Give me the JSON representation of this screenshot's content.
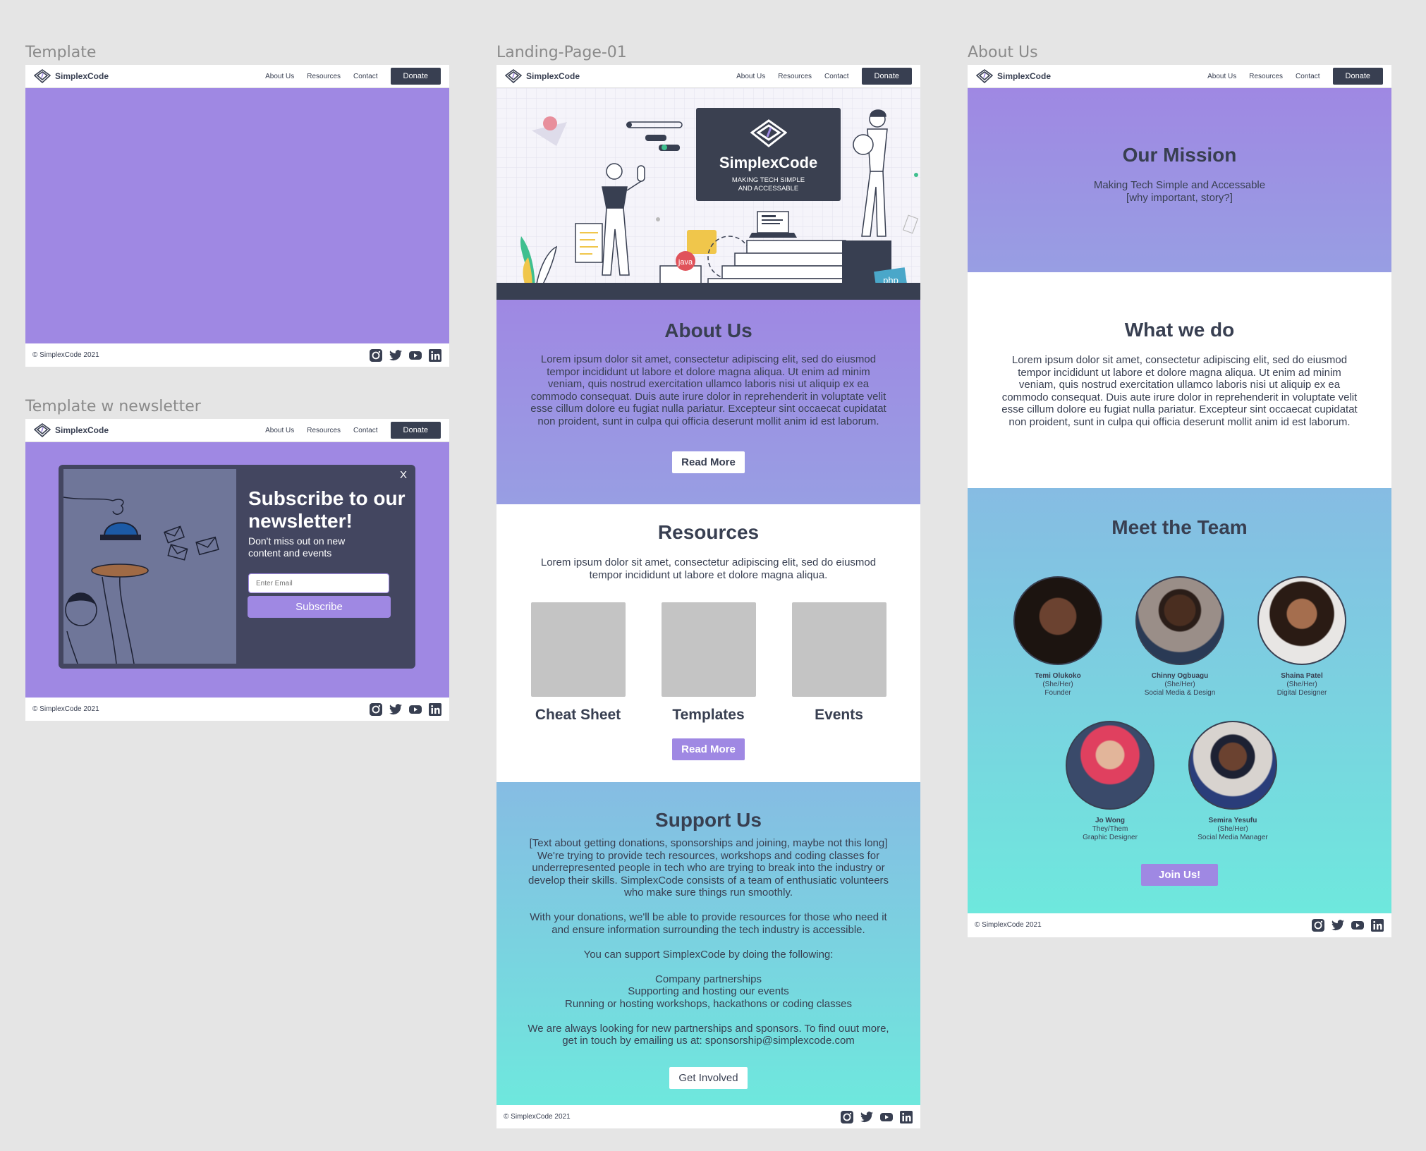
{
  "brand": {
    "name": "SimplexCode",
    "tagline": "MAKING TECH SIMPLE AND ACCESSABLE"
  },
  "nav": {
    "about": "About Us",
    "resources": "Resources",
    "contact": "Contact",
    "donate": "Donate"
  },
  "footer": {
    "copyright": "© SimplexCode 2021",
    "social_icons": [
      "instagram-icon",
      "twitter-icon",
      "youtube-icon",
      "linkedin-icon"
    ]
  },
  "frames": {
    "template": "Template",
    "newsletter": "Template w newsletter",
    "landing": "Landing-Page-01",
    "about": "About Us"
  },
  "newsletter": {
    "title": "Subscribe to our newsletter!",
    "subtitle": "Don't miss out on new content and events",
    "email_placeholder": "Enter Email",
    "subscribe": "Subscribe",
    "close": "X"
  },
  "hero": {
    "badges": [
      "java",
      "php"
    ]
  },
  "landing": {
    "about_title": "About Us",
    "about_text": "Lorem ipsum dolor sit amet, consectetur adipiscing elit, sed do eiusmod tempor incididunt ut labore et dolore magna aliqua. Ut enim ad minim veniam, quis nostrud exercitation ullamco laboris nisi ut aliquip ex ea commodo consequat. Duis aute irure dolor in reprehenderit in voluptate velit esse cillum dolore eu fugiat nulla pariatur. Excepteur sint occaecat cupidatat non proident, sunt in culpa qui officia deserunt mollit anim id est laborum.",
    "read_more": "Read More",
    "resources_title": "Resources",
    "resources_text": "Lorem ipsum dolor sit amet, consectetur adipiscing elit, sed do eiusmod tempor incididunt ut labore et dolore magna aliqua.",
    "cards": [
      "Cheat Sheet",
      "Templates",
      "Events"
    ],
    "resources_read_more": "Read More",
    "support_title": "Support Us",
    "support_paragraphs": [
      "[Text about getting donations, sponsorships and joining, maybe not this long] We're trying to provide tech resources, workshops and coding classes for underrepresented people in tech who are trying to break into the industry or develop their skills. SimplexCode consists of a team of enthusiatic volunteers who make sure things run smoothly.",
      "With your donations, we'll be able to provide resources for those who need it and ensure information surrounding the tech industry is accessible.",
      "You can support SimplexCode by doing the following:",
      "Company partnerships\nSupporting and hosting our events\nRunning or hosting workshops, hackathons or coding classes",
      "We are always looking for new partnerships and sponsors. To find ouut more, get in touch by emailing us at: sponsorship@simplexcode.com"
    ],
    "get_involved": "Get Involved"
  },
  "about": {
    "mission_title": "Our Mission",
    "mission_text": "Making Tech Simple and Accessable",
    "mission_note": "[why important, story?]",
    "what_title": "What we do",
    "what_text": "Lorem ipsum dolor sit amet, consectetur adipiscing elit, sed do eiusmod tempor incididunt ut labore et dolore magna aliqua. Ut enim ad minim veniam, quis nostrud exercitation ullamco laboris nisi ut aliquip ex ea commodo consequat. Duis aute irure dolor in reprehenderit in voluptate velit esse cillum dolore eu fugiat nulla pariatur. Excepteur sint occaecat cupidatat non proident, sunt in culpa qui officia deserunt mollit anim id est laborum.",
    "team_title": "Meet the Team",
    "team": [
      {
        "name": "Temi Olukoko",
        "pronouns": "(She/Her)",
        "role": "Founder"
      },
      {
        "name": "Chinny Ogbuagu",
        "pronouns": "(She/Her)",
        "role": "Social Media & Design"
      },
      {
        "name": "Shaina Patel",
        "pronouns": "(She/Her)",
        "role": "Digital Designer"
      },
      {
        "name": "Jo Wong",
        "pronouns": "They/Them",
        "role": "Graphic Designer"
      },
      {
        "name": "Semira Yesufu",
        "pronouns": "(She/Her)",
        "role": "Social Media Manager"
      }
    ],
    "join": "Join Us!"
  },
  "colors": {
    "purple": "#9f88e3",
    "navy": "#383f51",
    "teal": "#6ee8dd",
    "blue": "#86bce3"
  }
}
